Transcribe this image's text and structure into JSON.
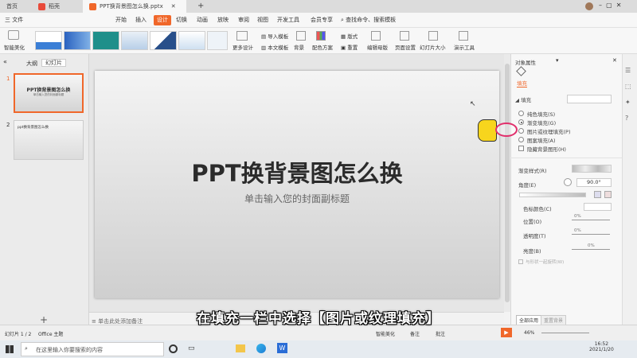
{
  "tabs": {
    "home": "首页",
    "app": "稻壳",
    "doc": "PPT换背景图怎么换.pptx",
    "add": "+"
  },
  "menu": {
    "file": "三 文件",
    "items": [
      "开始",
      "插入",
      "设计",
      "切换",
      "动画",
      "放映",
      "审阅",
      "视图",
      "开发工具",
      "会员专享"
    ],
    "search": "查找命令、搜索模板"
  },
  "ribbon": {
    "smart": "智能美化",
    "more": "更多设计",
    "import": "导入模板",
    "textmodel": "本文模板",
    "bg": "背景",
    "scheme": "配色方案",
    "layout": "版式",
    "reset": "重置",
    "master": "编辑母版",
    "page": "页面设置",
    "size": "幻灯片大小",
    "tools": "演示工具"
  },
  "left": {
    "outline": "大纲",
    "slides": "幻灯片",
    "s1_title": "PPT换背景图怎么换",
    "s1_sub": "单击输入您的封面副标题",
    "s2_title": "ppt换背景图怎么换"
  },
  "slide": {
    "title": "PPT换背景图怎么换",
    "subtitle": "单击输入您的封面副标题"
  },
  "notes": "单击此处添加备注",
  "panel": {
    "title": "对象属性",
    "tab": "填充",
    "section": "填充",
    "opts": [
      "纯色填充(S)",
      "渐变填充(G)",
      "图片或纹理填充(P)",
      "图案填充(A)",
      "隐藏背景图形(H)"
    ],
    "gstyle": "渐变样式(R)",
    "angle": "角度(E)",
    "angle_val": "90.0°",
    "color": "色标颜色(C)",
    "pos": "位置(O)",
    "pos_val": "0%",
    "trans": "透明度(T)",
    "trans_val": "0%",
    "bright": "亮度(B)",
    "bright_val": "0%",
    "rotate": "与形状一起旋转(W)",
    "apply_all": "全部应用",
    "reset": "重置背景"
  },
  "status": {
    "page": "幻灯片 1 / 2",
    "theme": "Office 主题",
    "beautify": "智能美化",
    "remark": "备注",
    "comment": "批注",
    "zoom": "46%"
  },
  "task": {
    "search": "在这里输入你要搜索的内容",
    "time": "16:52",
    "date": "2021/1/20"
  },
  "caption": "在填充一栏中选择【图片或纹理填充】",
  "colors": {
    "accent": "#f0672a",
    "slide_bg": "#e3e3e3"
  }
}
